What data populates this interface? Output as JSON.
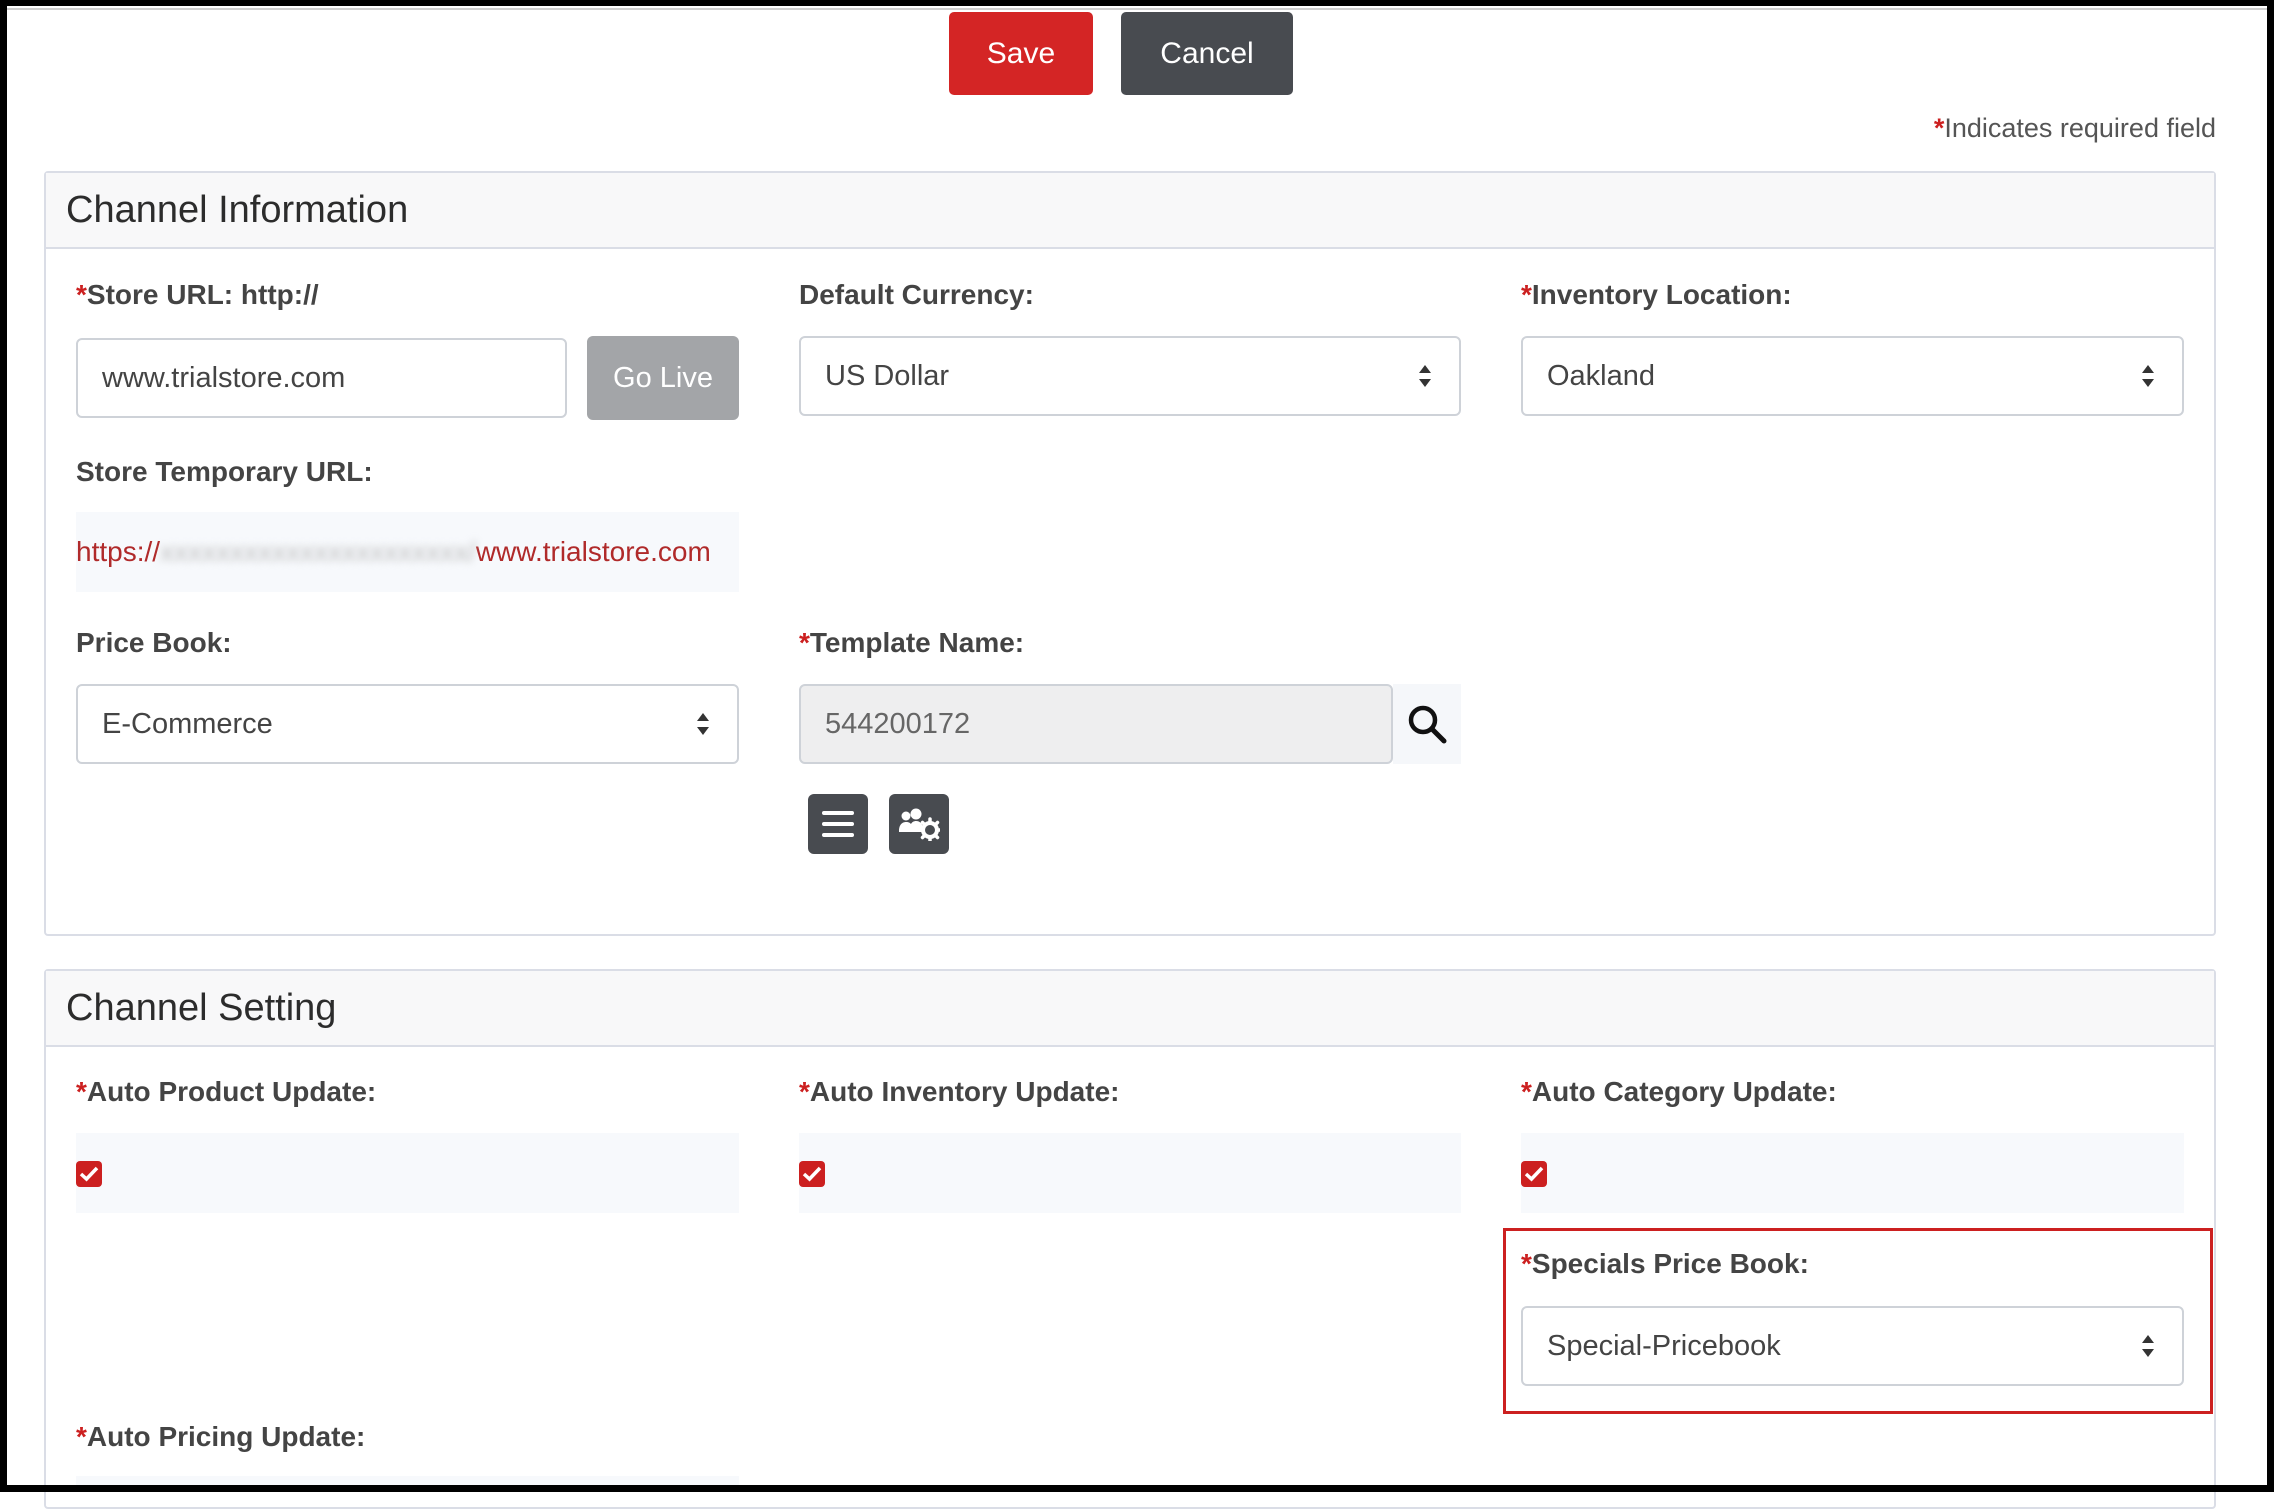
{
  "toolbar": {
    "save_label": "Save",
    "cancel_label": "Cancel"
  },
  "required_note": {
    "asterisk": "*",
    "text": "Indicates required field"
  },
  "channel_information": {
    "title": "Channel Information",
    "store_url": {
      "label": "Store URL: http://",
      "value": "www.trialstore.com",
      "go_live_label": "Go Live"
    },
    "default_currency": {
      "label": "Default Currency:",
      "value": "US Dollar"
    },
    "inventory_location": {
      "label": "Inventory Location:",
      "value": "Oakland"
    },
    "store_temporary_url": {
      "label": "Store Temporary URL:",
      "prefix": "https://",
      "suffix": "www.trialstore.com"
    },
    "price_book": {
      "label": "Price Book:",
      "value": "E-Commerce"
    },
    "template_name": {
      "label": "Template Name:",
      "value": "544200172"
    }
  },
  "channel_setting": {
    "title": "Channel Setting",
    "auto_product_update": {
      "label": "Auto Product Update:",
      "checked": true
    },
    "auto_inventory_update": {
      "label": "Auto Inventory Update:",
      "checked": true
    },
    "auto_category_update": {
      "label": "Auto Category Update:",
      "checked": true
    },
    "specials_price_book": {
      "label": "Specials Price Book:",
      "value": "Special-Pricebook"
    },
    "auto_pricing_update": {
      "label": "Auto Pricing Update:"
    }
  },
  "colors": {
    "accent_red": "#d42525",
    "dark_button": "#484b50",
    "highlight_border": "#cc2020"
  },
  "icons": [
    "search-icon",
    "list-icon",
    "users-gear-icon",
    "checkmark-icon",
    "select-caret-icon"
  ]
}
